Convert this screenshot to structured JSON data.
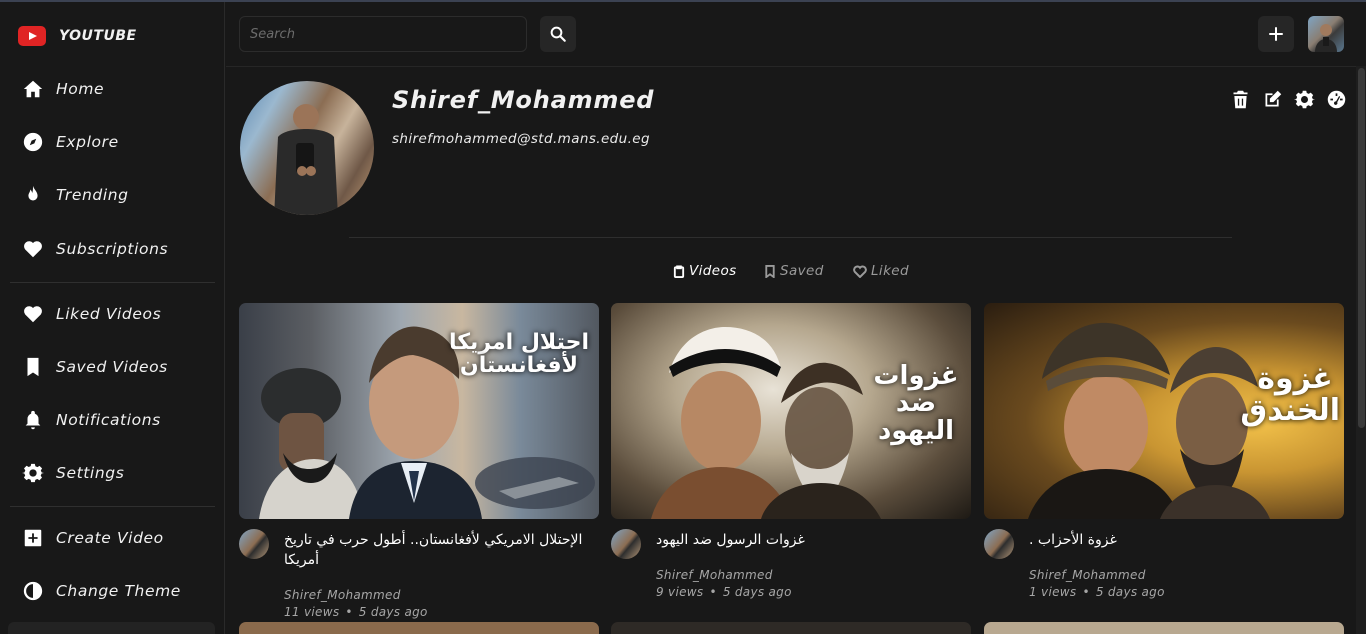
{
  "app": {
    "name": "YOUTUBE",
    "brand_color": "#e02424"
  },
  "sidebar": {
    "items": [
      {
        "label": "Home",
        "icon": "home-icon"
      },
      {
        "label": "Explore",
        "icon": "compass-icon"
      },
      {
        "label": "Trending",
        "icon": "fire-icon"
      },
      {
        "label": "Subscriptions",
        "icon": "heart-icon"
      },
      {
        "label": "Liked Videos",
        "icon": "heart-icon"
      },
      {
        "label": "Saved Videos",
        "icon": "bookmark-icon"
      },
      {
        "label": "Notifications",
        "icon": "bell-icon"
      },
      {
        "label": "Settings",
        "icon": "gear-icon"
      },
      {
        "label": "Create Video",
        "icon": "plus-square-icon"
      },
      {
        "label": "Change Theme",
        "icon": "half-circle-icon"
      }
    ]
  },
  "header": {
    "search_placeholder": "Search",
    "search_icon": "search-icon",
    "create_icon": "plus-icon"
  },
  "profile": {
    "name": "Shiref_Mohammed",
    "email": "shirefmohammed@std.mans.edu.eg",
    "actions": [
      "trash-icon",
      "edit-icon",
      "gear-icon",
      "dashboard-icon"
    ]
  },
  "tabs": [
    {
      "label": "Videos",
      "icon": "clipboard-icon",
      "active": true
    },
    {
      "label": "Saved",
      "icon": "bookmark-icon",
      "active": false
    },
    {
      "label": "Liked",
      "icon": "heart-outline-icon",
      "active": false
    }
  ],
  "videos": [
    {
      "thumb_text": "احتلال امريكا لأفغانستان",
      "title": "الإحتلال الامريكي لأفغانستان.. أطول حرب في تاريخ أمريكا",
      "channel": "Shiref_Mohammed",
      "views": "11 views",
      "age": "5 days ago"
    },
    {
      "thumb_text": "غزوات ضد اليهود",
      "title": "غزوات الرسول ضد اليهود",
      "channel": "Shiref_Mohammed",
      "views": "9 views",
      "age": "5 days ago"
    },
    {
      "thumb_text": "غزوة الخندق",
      "title": "غزوة الأحزاب .",
      "channel": "Shiref_Mohammed",
      "views": "1 views",
      "age": "5 days ago"
    }
  ]
}
